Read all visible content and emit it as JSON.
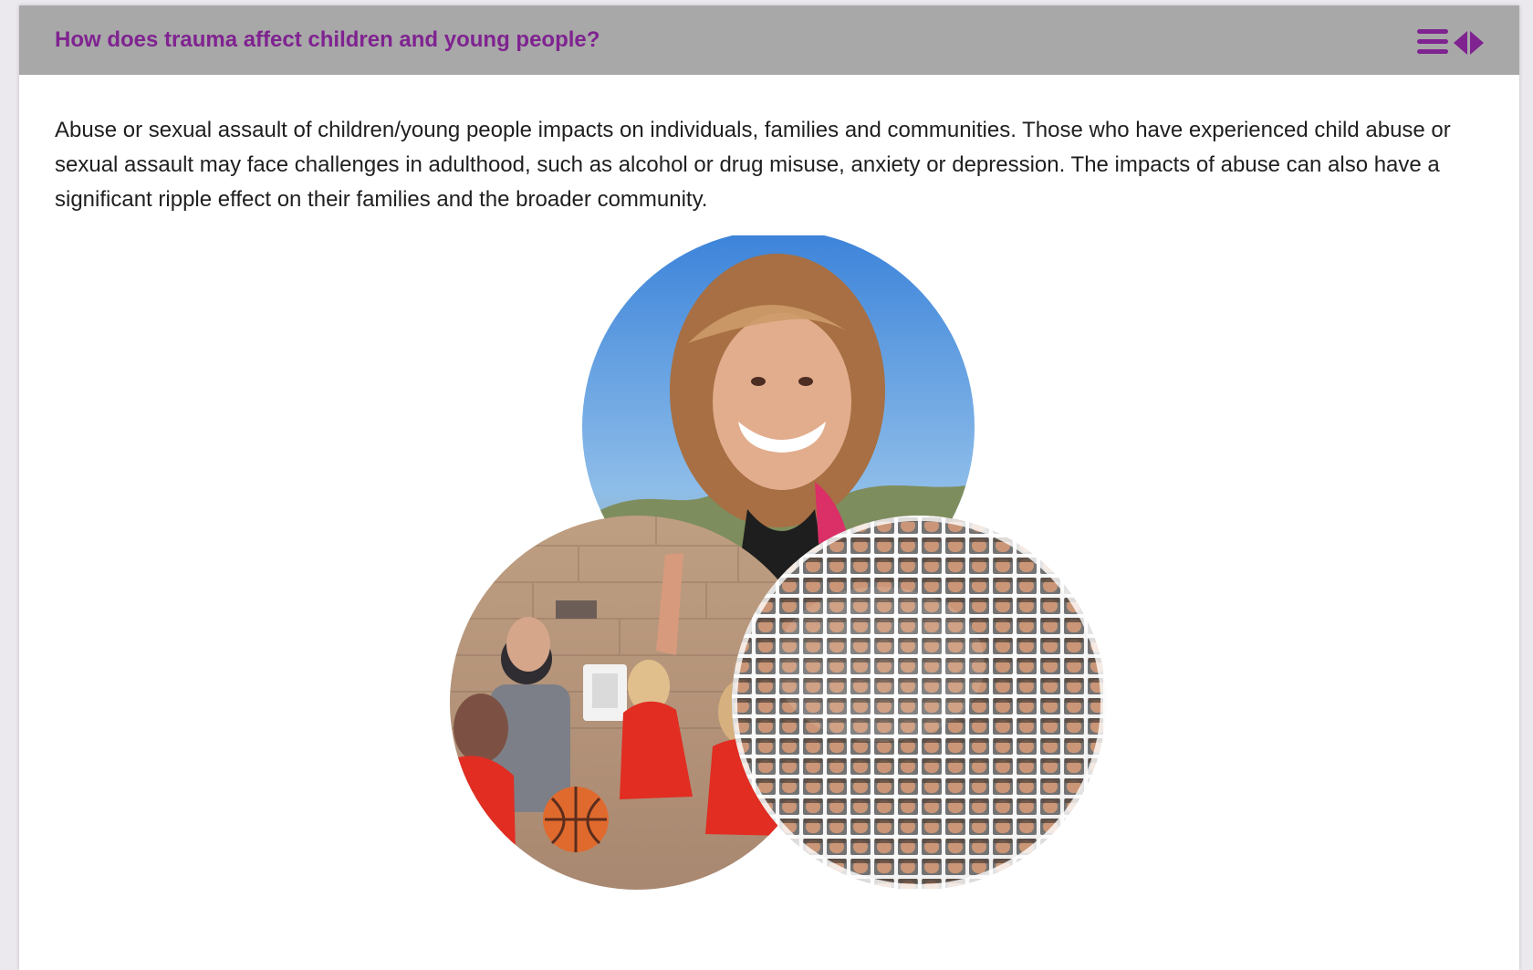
{
  "header": {
    "title": "How does trauma affect children and young people?",
    "icons": [
      "menu-icon",
      "previous-icon",
      "next-icon"
    ]
  },
  "content": {
    "paragraph": "Abuse or sexual assault of children/young people impacts on individuals, families and communities. Those who have experienced child abuse or sexual assault may face challenges in adulthood, such as alcohol or drug misuse, anxiety or depression. The impacts of abuse can also have a significant ripple effect on their families and the broader community."
  },
  "colors": {
    "accent": "#7f2390",
    "header_background": "#a8a8a8",
    "page_background": "#ebe8ee",
    "card_background": "#ffffff"
  }
}
